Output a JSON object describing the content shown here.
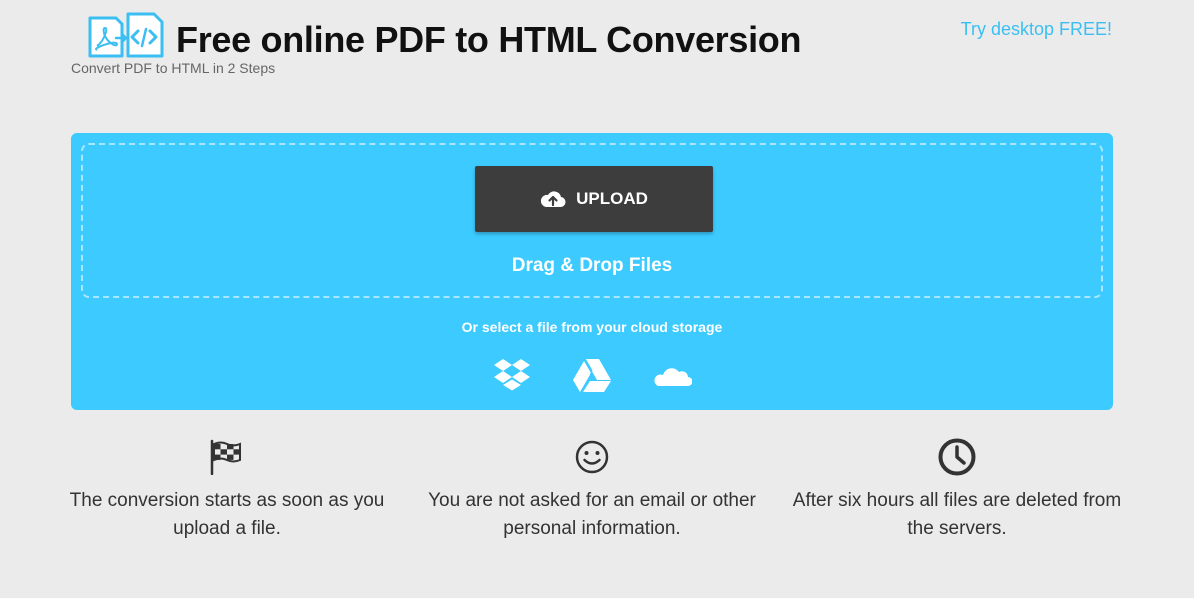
{
  "header": {
    "title": "Free online PDF to HTML Conversion",
    "subtitle": "Convert PDF to HTML in 2 Steps",
    "desktop_link": "Try desktop FREE!",
    "logo_icon": "pdf-to-html-logo-icon"
  },
  "upload": {
    "button_label": "UPLOAD",
    "button_icon": "cloud-upload-icon",
    "drag_text": "Drag & Drop Files",
    "cloud_text": "Or select a file from your cloud storage",
    "cloud_services": [
      {
        "icon": "dropbox-icon"
      },
      {
        "icon": "google-drive-icon"
      },
      {
        "icon": "onedrive-icon"
      }
    ]
  },
  "features": [
    {
      "icon": "checkered-flag-icon",
      "text": "The conversion starts as soon as you upload a file."
    },
    {
      "icon": "smiley-icon",
      "text": "You are not asked for an email or other personal information."
    },
    {
      "icon": "clock-icon",
      "text": "After six hours all files are deleted from the servers."
    }
  ],
  "colors": {
    "accent": "#3ccaff",
    "link": "#3bbff3",
    "button": "#3d3d3d",
    "background": "#ebebeb"
  }
}
